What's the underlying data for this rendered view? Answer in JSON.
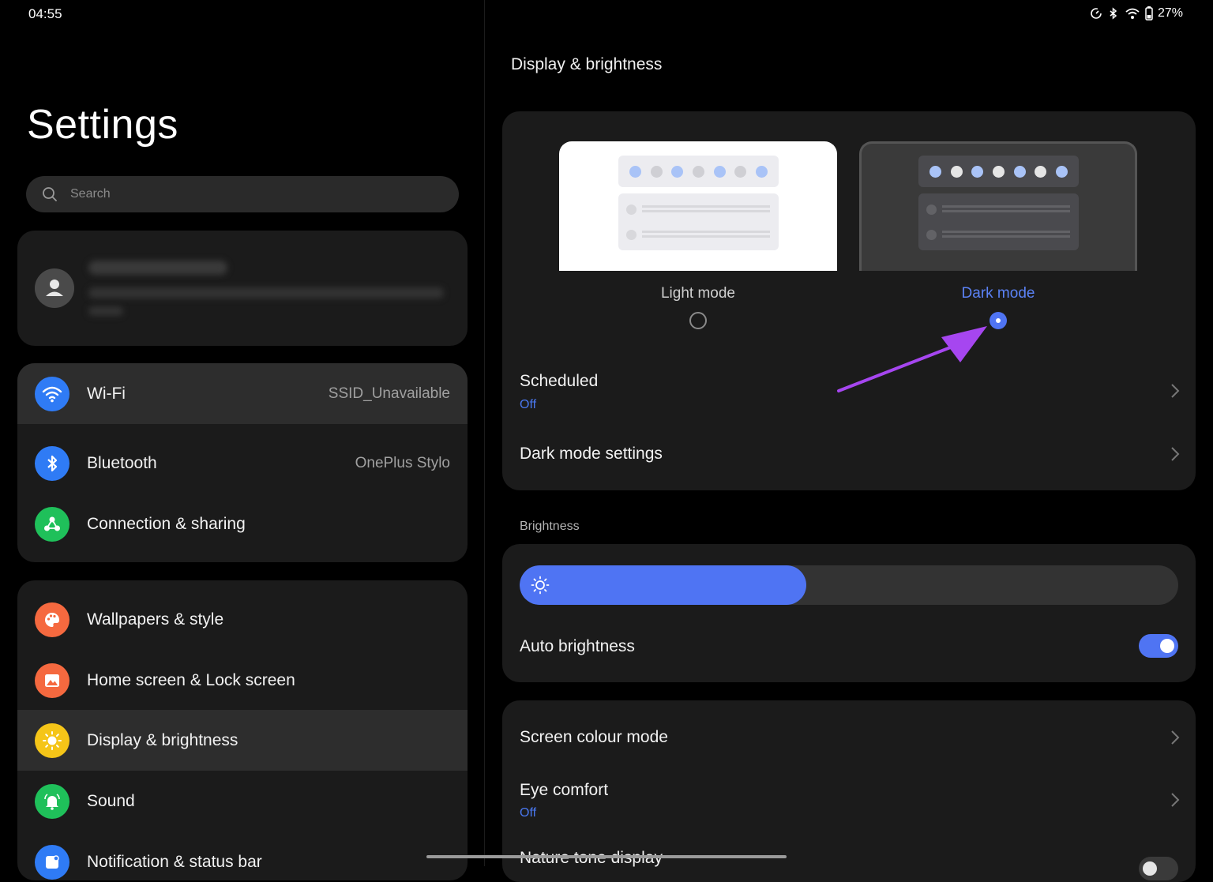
{
  "status_bar": {
    "time": "04:55",
    "battery": "27%"
  },
  "left": {
    "title": "Settings",
    "search_placeholder": "Search",
    "group1": [
      {
        "label": "Wi-Fi",
        "value": "SSID_Unavailable",
        "icon": "wifi-icon",
        "color": "#2f7bf5"
      },
      {
        "label": "Bluetooth",
        "value": "OnePlus Stylo",
        "icon": "bluetooth-icon",
        "color": "#2f7bf5"
      },
      {
        "label": "Connection & sharing",
        "value": "",
        "icon": "connection-icon",
        "color": "#1fc05a"
      }
    ],
    "group2": [
      {
        "label": "Wallpapers & style",
        "icon": "palette-icon",
        "color": "#f5693f"
      },
      {
        "label": "Home screen & Lock screen",
        "icon": "picture-icon",
        "color": "#f5693f"
      },
      {
        "label": "Display & brightness",
        "icon": "sun-icon",
        "color": "#f5c518"
      },
      {
        "label": "Sound",
        "icon": "bell-icon",
        "color": "#1fc05a"
      },
      {
        "label": "Notification & status bar",
        "icon": "notification-icon",
        "color": "#2f7bf5"
      }
    ]
  },
  "right": {
    "title": "Display & brightness",
    "light_mode_label": "Light mode",
    "dark_mode_label": "Dark mode",
    "scheduled": {
      "label": "Scheduled",
      "value": "Off"
    },
    "dark_mode_settings": "Dark mode settings",
    "brightness_label": "Brightness",
    "brightness_level": 0.435,
    "auto_brightness": "Auto brightness",
    "screen_colour_mode": "Screen colour mode",
    "eye_comfort": {
      "label": "Eye comfort",
      "value": "Off"
    },
    "nature_tone": "Nature tone display",
    "accent": "#4f74f3",
    "annotation_arrow_color": "#a646f0"
  }
}
